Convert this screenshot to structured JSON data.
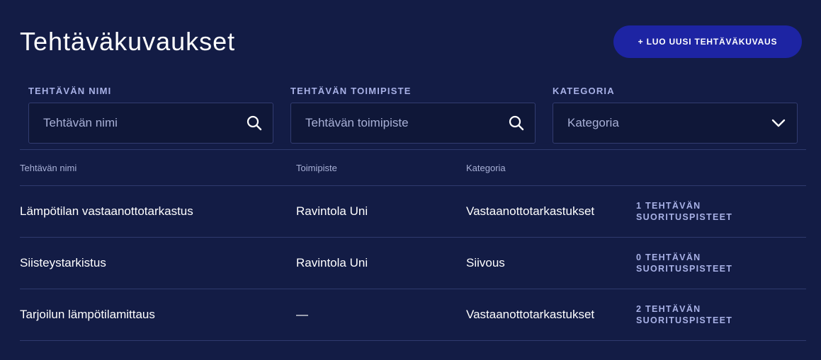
{
  "page": {
    "title": "Tehtäväkuvaukset",
    "create_button_label": "+ LUO UUSI TEHTÄVÄKUVAUS"
  },
  "filters": {
    "name": {
      "label": "TEHTÄVÄN NIMI",
      "placeholder": "Tehtävän nimi",
      "icon": "search-icon"
    },
    "location": {
      "label": "TEHTÄVÄN TOIMIPISTE",
      "placeholder": "Tehtävän toimipiste",
      "icon": "search-icon"
    },
    "category": {
      "label": "KATEGORIA",
      "value": "Kategoria",
      "icon": "chevron-down-icon"
    }
  },
  "table": {
    "headers": {
      "name": "Tehtävän nimi",
      "location": "Toimipiste",
      "category": "Kategoria"
    },
    "rows": [
      {
        "name": "Lämpötilan vastaanottotarkastus",
        "location": "Ravintola Uni",
        "category": "Vastaanottotarkastukset",
        "points_line1": "1 TEHTÄVÄN",
        "points_line2": "SUORITUSPISTEET"
      },
      {
        "name": "Siisteystarkistus",
        "location": "Ravintola Uni",
        "category": "Siivous",
        "points_line1": "0 TEHTÄVÄN",
        "points_line2": "SUORITUSPISTEET"
      },
      {
        "name": "Tarjoilun lämpötilamittaus",
        "location": "—",
        "category": "Vastaanottotarkastukset",
        "points_line1": "2 TEHTÄVÄN",
        "points_line2": "SUORITUSPISTEET"
      }
    ]
  },
  "colors": {
    "background": "#131c45",
    "accent": "#1d24a3",
    "label": "#a8b1e6"
  }
}
